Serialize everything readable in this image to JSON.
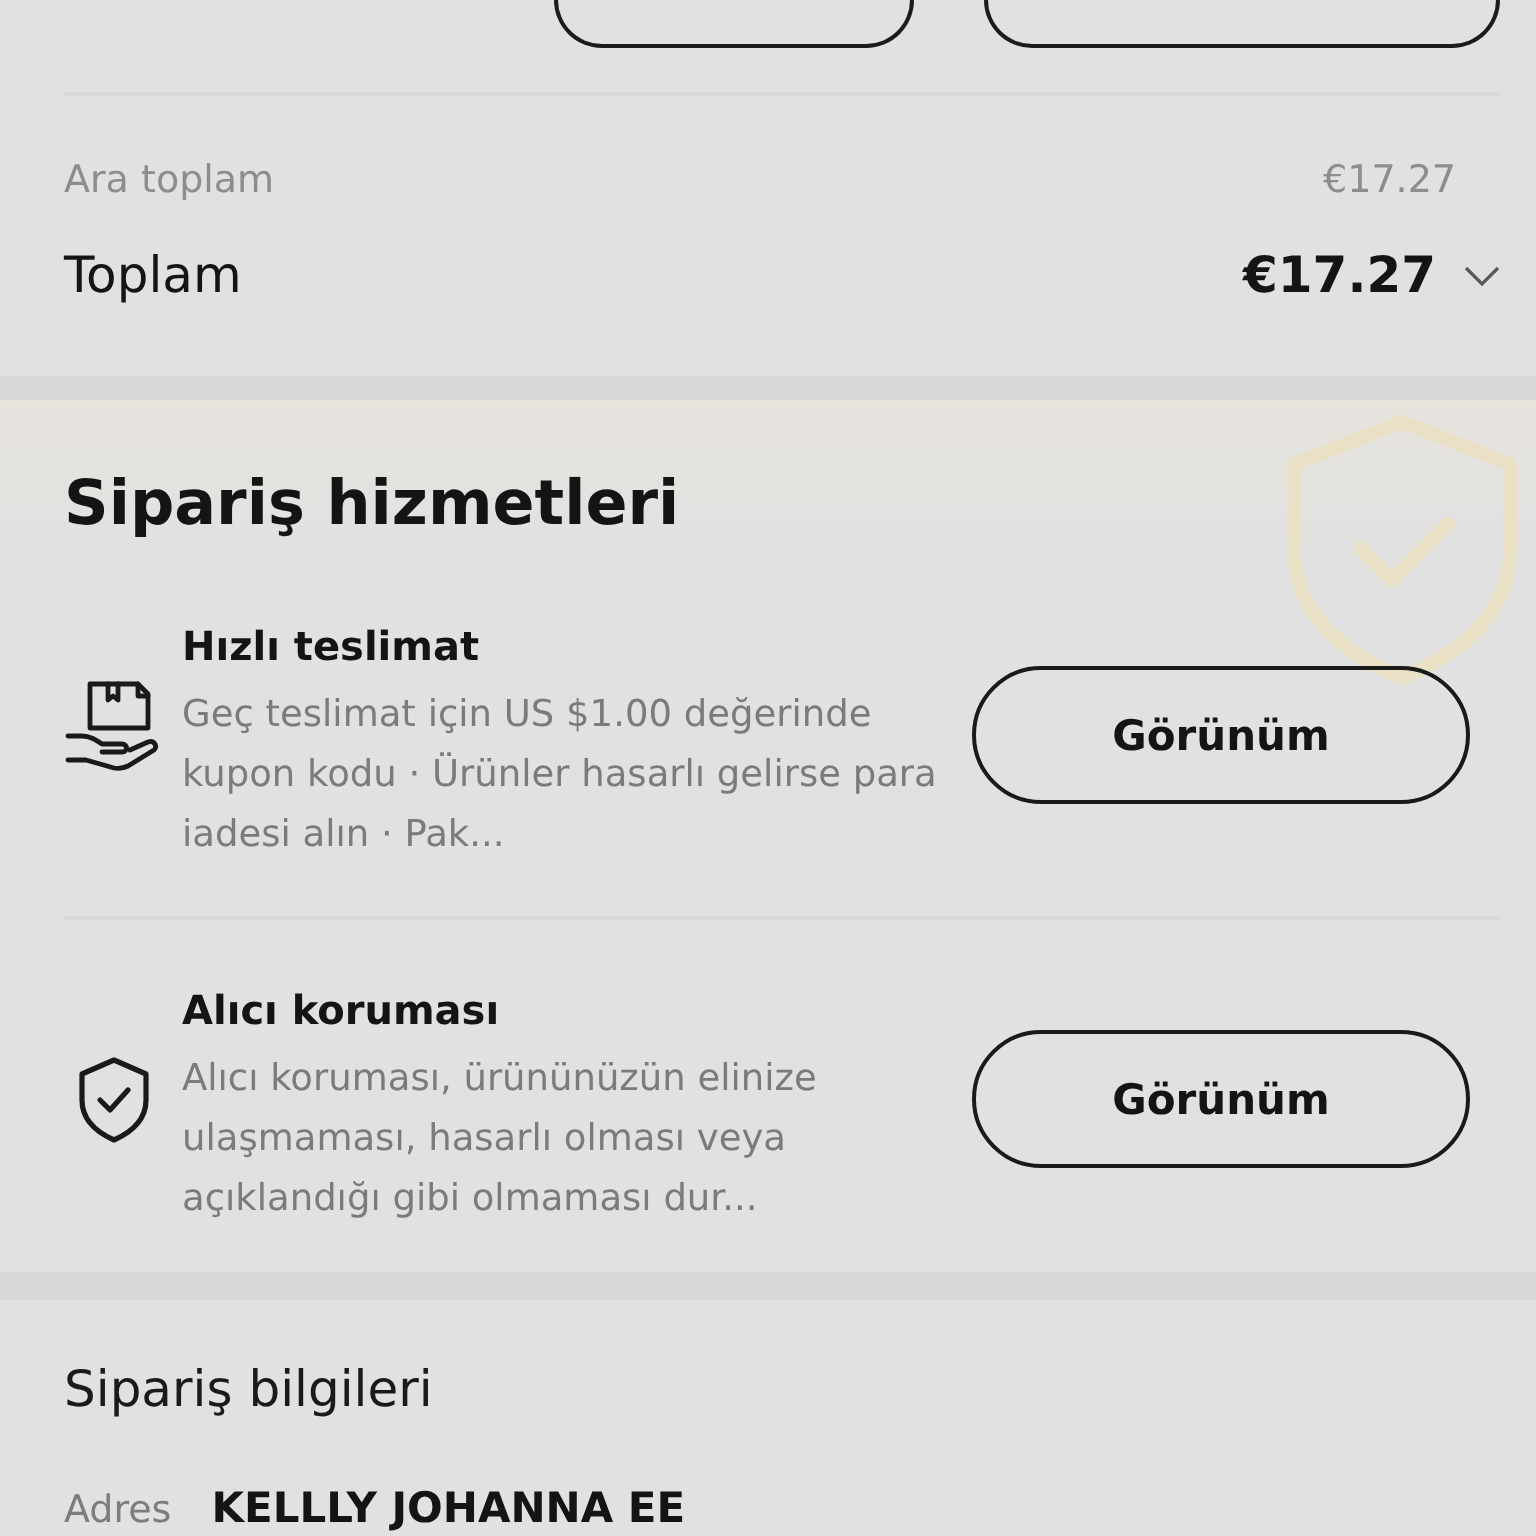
{
  "top_actions": [
    {
      "kind": "outline"
    },
    {
      "kind": "outline"
    }
  ],
  "summary": {
    "subtotal": {
      "label": "Ara toplam",
      "value": "€17.27"
    },
    "total": {
      "label": "Toplam",
      "value": "€17.27",
      "expanded": false
    }
  },
  "order_services": {
    "title": "Sipariş hizmetleri",
    "items": [
      {
        "kind": "delivery",
        "title": "Hızlı teslimat",
        "description": "Geç teslimat için US $1.00 değerinde kupon kodu · Ürünler hasarlı gelirse para iadesi alın · Pak...",
        "button": "Görünüm"
      },
      {
        "kind": "protection",
        "title": "Alıcı koruması",
        "description": "Alıcı koruması, ürününüzün elinize ulaşmaması, hasarlı olması veya açıklandığı gibi olmaması dur...",
        "button": "Görünüm"
      }
    ]
  },
  "order_info": {
    "title": "Sipariş bilgileri",
    "fields": [
      {
        "label": "Adres",
        "value": "KELLLY JOHANNA EE"
      }
    ]
  }
}
